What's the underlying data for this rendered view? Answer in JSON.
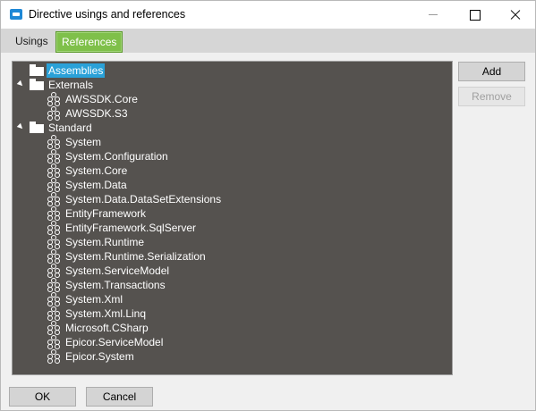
{
  "window": {
    "title": "Directive usings and references"
  },
  "tabs": [
    {
      "label": "Usings",
      "active": false
    },
    {
      "label": "References",
      "active": true
    }
  ],
  "tree": {
    "nodes": [
      {
        "label": "Assemblies",
        "type": "folder",
        "level": 0,
        "expanded": null,
        "selected": true
      },
      {
        "label": "Externals",
        "type": "folder",
        "level": 0,
        "expanded": true,
        "selected": false
      },
      {
        "label": "AWSSDK.Core",
        "type": "assembly",
        "level": 1
      },
      {
        "label": "AWSSDK.S3",
        "type": "assembly",
        "level": 1
      },
      {
        "label": "Standard",
        "type": "folder",
        "level": 0,
        "expanded": true,
        "selected": false
      },
      {
        "label": "System",
        "type": "assembly",
        "level": 1
      },
      {
        "label": "System.Configuration",
        "type": "assembly",
        "level": 1
      },
      {
        "label": "System.Core",
        "type": "assembly",
        "level": 1
      },
      {
        "label": "System.Data",
        "type": "assembly",
        "level": 1
      },
      {
        "label": "System.Data.DataSetExtensions",
        "type": "assembly",
        "level": 1
      },
      {
        "label": "EntityFramework",
        "type": "assembly",
        "level": 1
      },
      {
        "label": "EntityFramework.SqlServer",
        "type": "assembly",
        "level": 1
      },
      {
        "label": "System.Runtime",
        "type": "assembly",
        "level": 1
      },
      {
        "label": "System.Runtime.Serialization",
        "type": "assembly",
        "level": 1
      },
      {
        "label": "System.ServiceModel",
        "type": "assembly",
        "level": 1
      },
      {
        "label": "System.Transactions",
        "type": "assembly",
        "level": 1
      },
      {
        "label": "System.Xml",
        "type": "assembly",
        "level": 1
      },
      {
        "label": "System.Xml.Linq",
        "type": "assembly",
        "level": 1
      },
      {
        "label": "Microsoft.CSharp",
        "type": "assembly",
        "level": 1
      },
      {
        "label": "Epicor.ServiceModel",
        "type": "assembly",
        "level": 1
      },
      {
        "label": "Epicor.System",
        "type": "assembly",
        "level": 1
      }
    ]
  },
  "buttons": {
    "add": "Add",
    "remove": "Remove",
    "ok": "OK",
    "cancel": "Cancel"
  },
  "colors": {
    "tree_background": "#55524f",
    "selection": "#2aa1d8",
    "active_tab": "#7fc04a"
  }
}
